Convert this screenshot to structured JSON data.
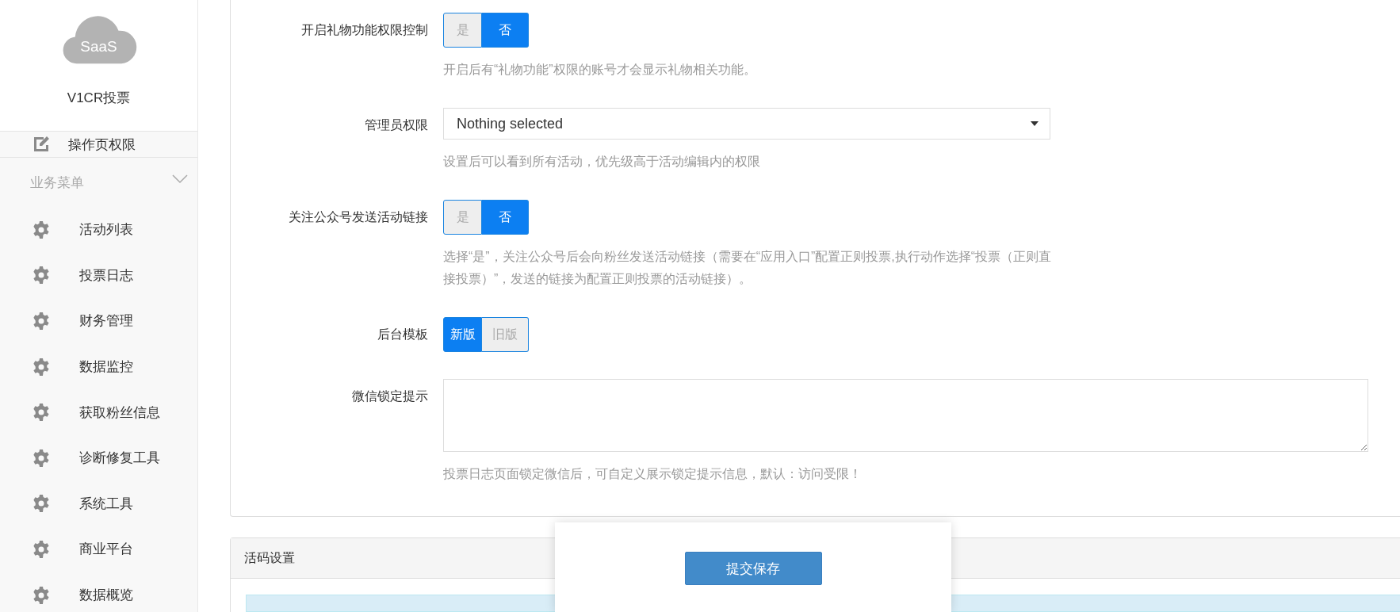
{
  "sidebar": {
    "logo_text": "SaaS",
    "app_name": "V1CR投票",
    "partial_item": "操作页权限",
    "section": {
      "title": "业务菜单",
      "expanded": true
    },
    "items": [
      {
        "label": "活动列表"
      },
      {
        "label": "投票日志"
      },
      {
        "label": "财务管理"
      },
      {
        "label": "数据监控"
      },
      {
        "label": "获取粉丝信息"
      },
      {
        "label": "诊断修复工具"
      },
      {
        "label": "系统工具"
      },
      {
        "label": "商业平台"
      },
      {
        "label": "数据概览"
      }
    ]
  },
  "form": {
    "fields": [
      {
        "kind": "toggle",
        "label": "开启礼物功能权限控制",
        "options": [
          {
            "label": "是",
            "selected": false
          },
          {
            "label": "否",
            "selected": true
          }
        ],
        "help": "开启后有“礼物功能”权限的账号才会显示礼物相关功能。"
      },
      {
        "kind": "select",
        "label": "管理员权限",
        "value": "Nothing selected",
        "help": "设置后可以看到所有活动，优先级高于活动编辑内的权限"
      },
      {
        "kind": "toggle",
        "label": "关注公众号发送活动链接",
        "options": [
          {
            "label": "是",
            "selected": false
          },
          {
            "label": "否",
            "selected": true
          }
        ],
        "help": "选择“是”，关注公众号后会向粉丝发送活动链接（需要在“应用入口”配置正则投票,执行动作选择“投票（正则直接投票）”，发送的链接为配置正则投票的活动链接）。"
      },
      {
        "kind": "toggle",
        "label": "后台模板",
        "options": [
          {
            "label": "新版",
            "selected": true
          },
          {
            "label": "旧版",
            "selected": false
          }
        ]
      },
      {
        "kind": "textarea",
        "label": "微信锁定提示",
        "help": "投票日志页面锁定微信后，可自定义展示锁定提示信息，默认：访问受限！"
      }
    ]
  },
  "panel2": {
    "title": "活码设置"
  },
  "save_button": "提交保存"
}
